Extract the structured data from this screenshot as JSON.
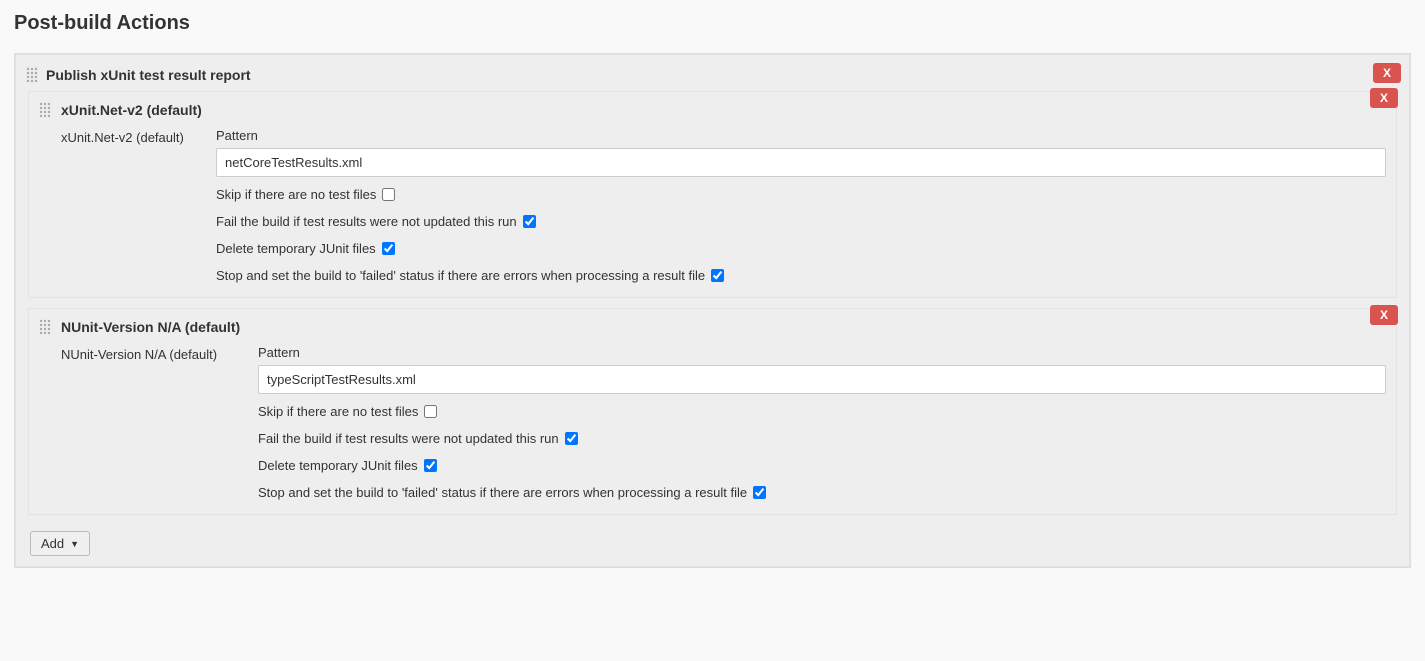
{
  "section_title": "Post-build Actions",
  "action": {
    "title": "Publish xUnit test result report",
    "delete_label": "X"
  },
  "tools": [
    {
      "header": "xUnit.Net-v2 (default)",
      "row_label": "xUnit.Net-v2 (default)",
      "pattern_label": "Pattern",
      "pattern_value": "netCoreTestResults.xml",
      "opts": {
        "skip_no_files": {
          "label": "Skip if there are no test files",
          "checked": false
        },
        "fail_not_updated": {
          "label": "Fail the build if test results were not updated this run",
          "checked": true
        },
        "delete_junit": {
          "label": "Delete temporary JUnit files",
          "checked": true
        },
        "stop_on_error": {
          "label": "Stop and set the build to 'failed' status if there are errors when processing a result file",
          "checked": true
        }
      },
      "delete_label": "X"
    },
    {
      "header": "NUnit-Version N/A (default)",
      "row_label": "NUnit-Version N/A (default)",
      "pattern_label": "Pattern",
      "pattern_value": "typeScriptTestResults.xml",
      "opts": {
        "skip_no_files": {
          "label": "Skip if there are no test files",
          "checked": false
        },
        "fail_not_updated": {
          "label": "Fail the build if test results were not updated this run",
          "checked": true
        },
        "delete_junit": {
          "label": "Delete temporary JUnit files",
          "checked": true
        },
        "stop_on_error": {
          "label": "Stop and set the build to 'failed' status if there are errors when processing a result file",
          "checked": true
        }
      },
      "delete_label": "X"
    }
  ],
  "add_button_label": "Add"
}
